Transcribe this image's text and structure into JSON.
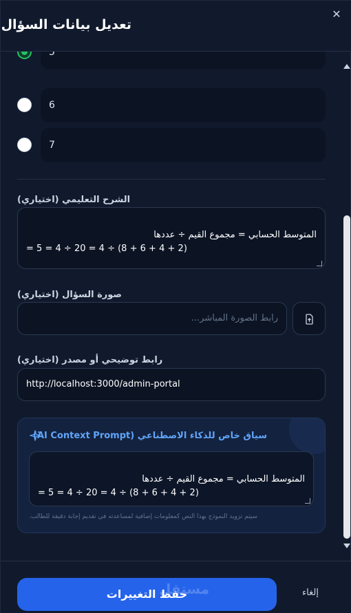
{
  "header": {
    "title": "تعديل بيانات السؤال",
    "close_icon": "✕"
  },
  "options": [
    {
      "value": "5",
      "selected": true
    },
    {
      "value": "6",
      "selected": false
    },
    {
      "value": "7",
      "selected": false
    }
  ],
  "explanation": {
    "label": "الشرح التعليمي (اختياري)",
    "value": "المتوسط الحسابي = مجموع القيم ÷ عددها\n= (2 + 4 + 6 + 8) ÷ 4 = 20 ÷ 4 = 5"
  },
  "image": {
    "label": "صورة السؤال (اختياري)",
    "placeholder": "رابط الصورة المباشر...",
    "upload_icon": "upload-icon"
  },
  "source": {
    "label": "رابط توضيحي أو مصدر (اختياري)",
    "value": "http://localhost:3000/admin-portal"
  },
  "ai_context": {
    "title": "سياق خاص للذكاء الاصطناعي (AI Context Prompt)",
    "value": "المتوسط الحسابي = مجموع القيم ÷ عددها\n= (2 + 4 + 6 + 8) ÷ 4 = 20 ÷ 4 = 5",
    "hint": "سيتم تزويد النموذج بهذا النص كمعلومات إضافية لمساعدته في تقديم إجابة دقيقة للطالب.",
    "icon": "sparkles-icon"
  },
  "footer": {
    "save_label": "حفظ التغييرات",
    "cancel_label": "إلغاء",
    "watermark": "مستقل"
  },
  "colors": {
    "background": "#111a2d",
    "accent": "#2563eb",
    "ai_accent": "#60a5fa",
    "selected": "#22c55e"
  }
}
